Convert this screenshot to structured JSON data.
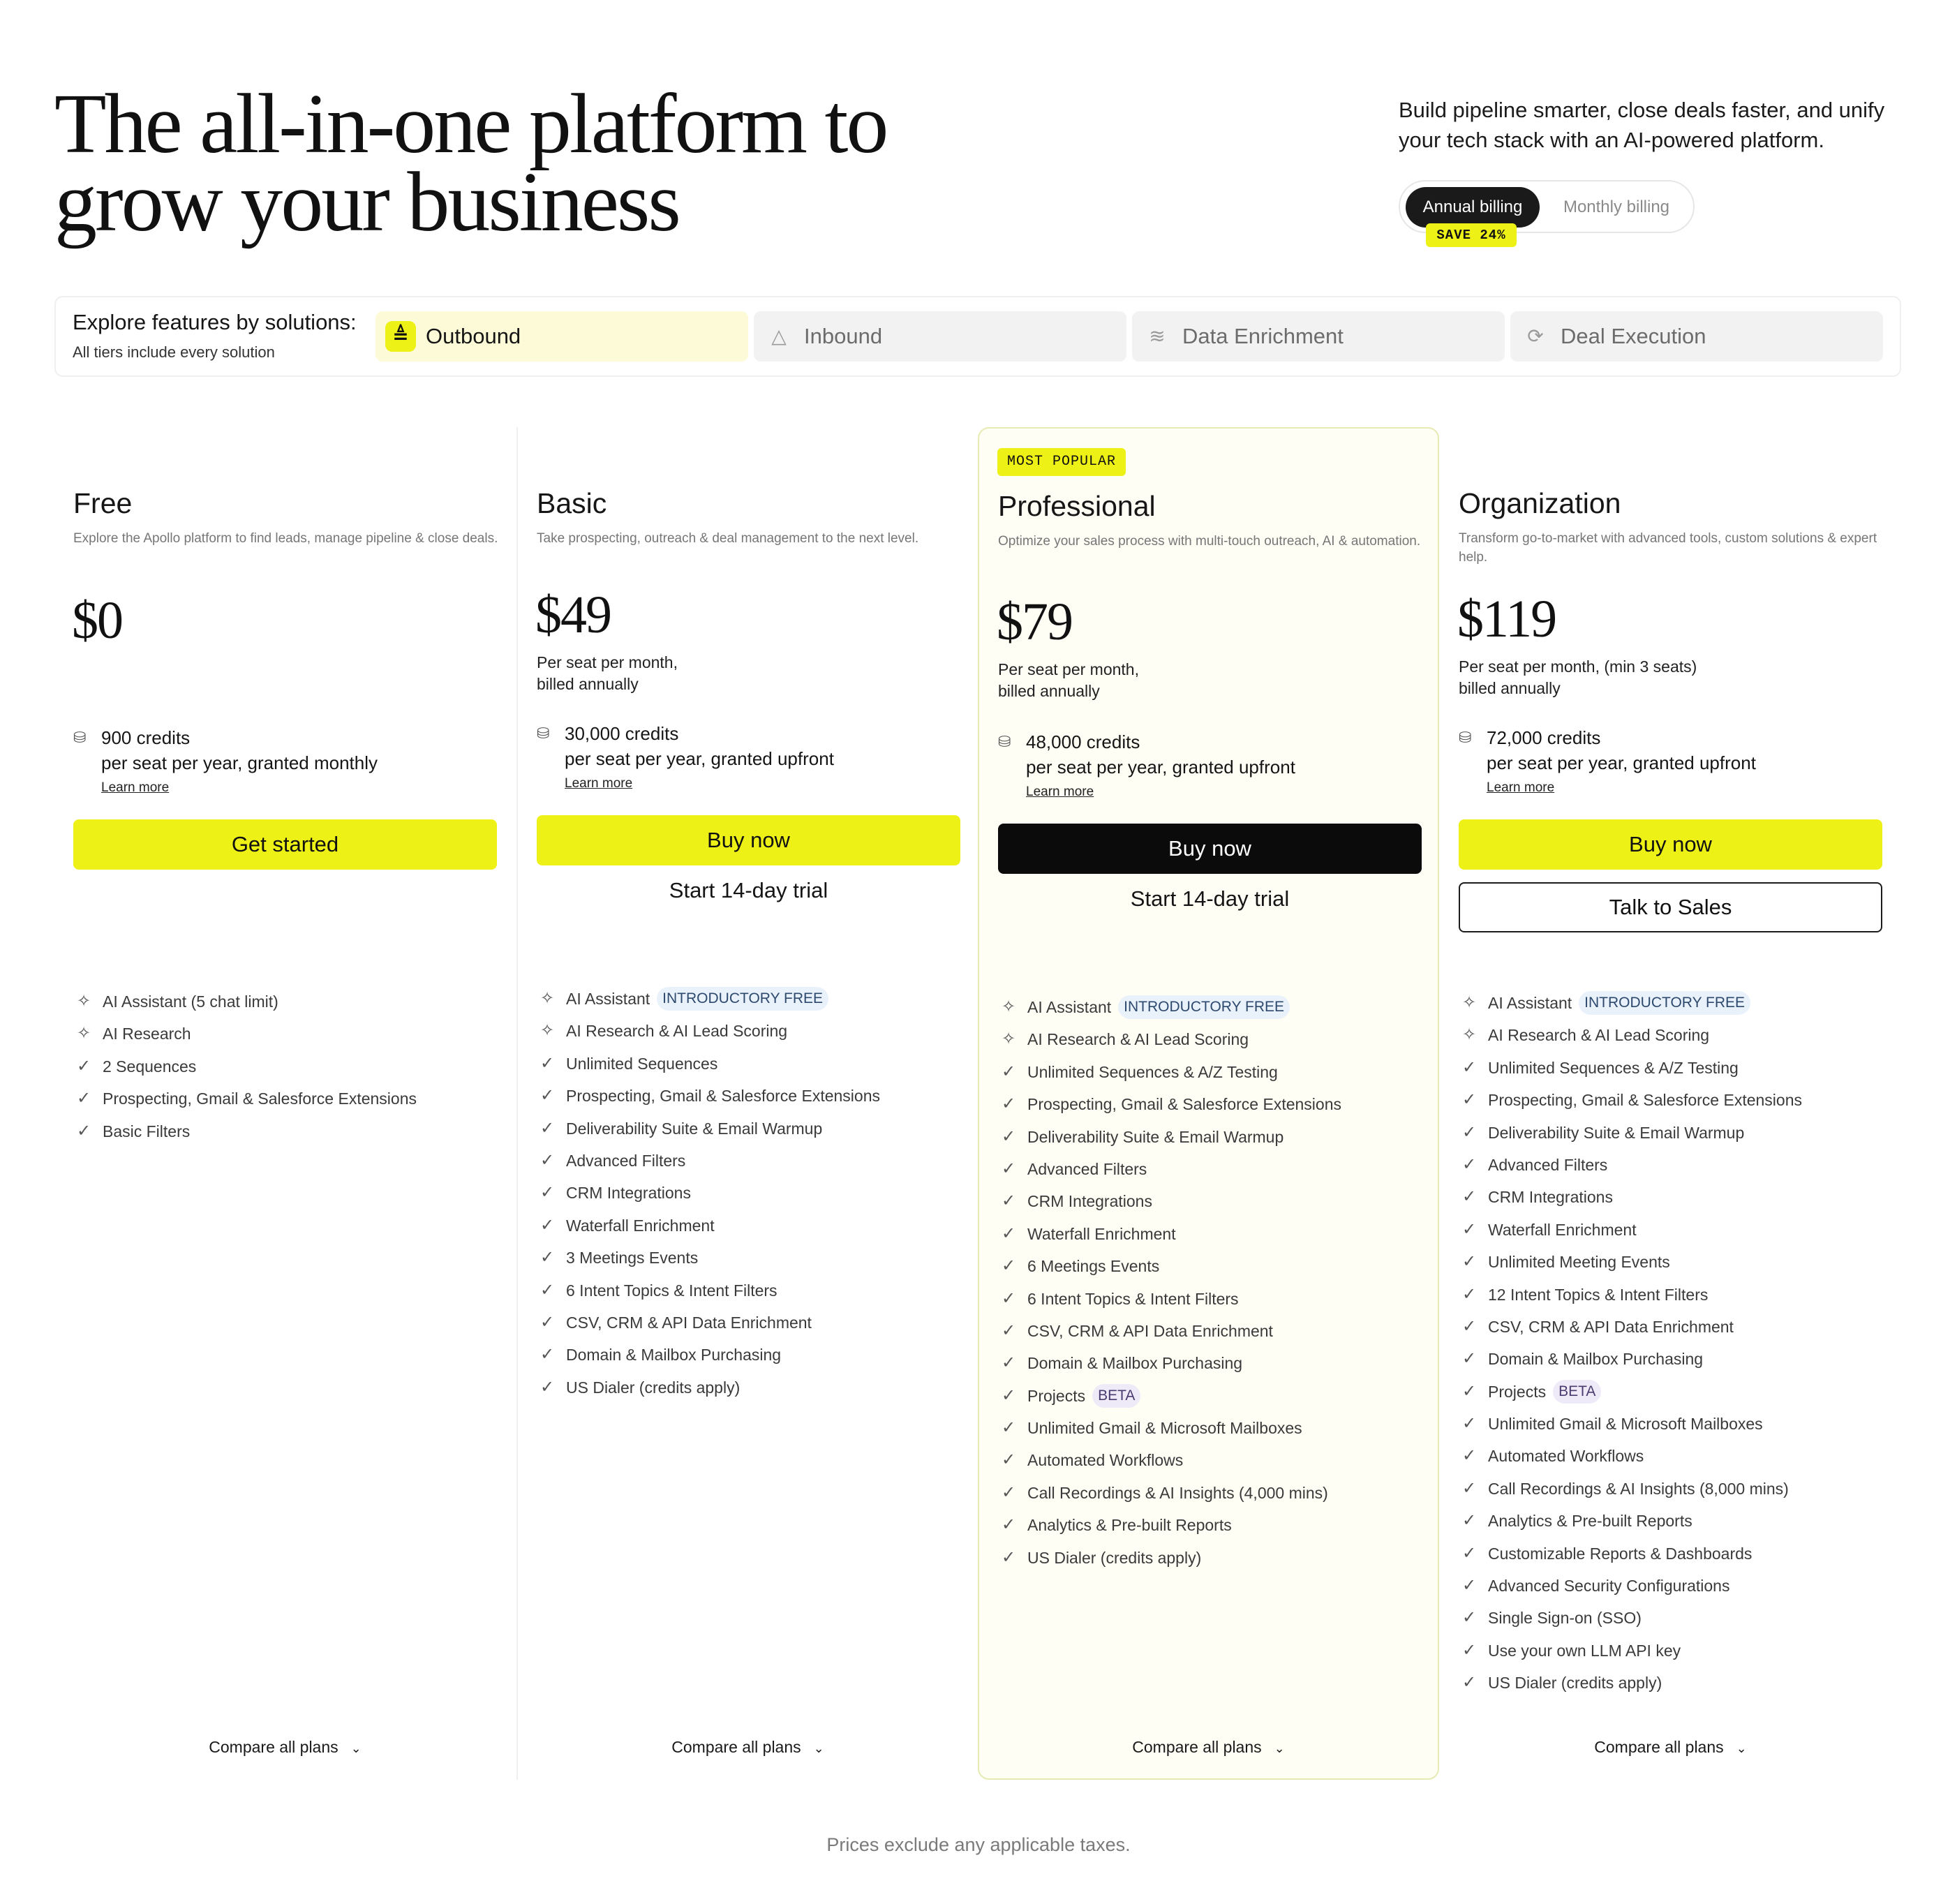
{
  "header": {
    "title_line1": "The all-in-one platform to",
    "title_line2": "grow your business",
    "subtitle": "Build pipeline smarter, close deals faster, and unify your tech stack with an AI-powered platform."
  },
  "billing": {
    "annual_label": "Annual billing",
    "monthly_label": "Monthly billing",
    "save_label": "SAVE 24%",
    "selected": "Annual billing"
  },
  "solutions": {
    "title": "Explore features by solutions:",
    "note": "All tiers include every solution",
    "tabs": [
      {
        "label": "Outbound",
        "icon": "outbound-icon",
        "active": true
      },
      {
        "label": "Inbound",
        "icon": "inbound-icon",
        "active": false
      },
      {
        "label": "Data Enrichment",
        "icon": "data-enrichment-icon",
        "active": false
      },
      {
        "label": "Deal Execution",
        "icon": "deal-execution-icon",
        "active": false
      }
    ]
  },
  "plans": [
    {
      "name": "Free",
      "description": "Explore the Apollo platform to find leads, manage pipeline & close deals.",
      "price": "$0",
      "billing": [
        "",
        ""
      ],
      "credits_amount": "900 credits",
      "credits_detail": "per seat per year, granted monthly",
      "learn_more": "Learn more",
      "primary_cta": "Get started",
      "secondary_cta": "",
      "features": [
        {
          "text": "AI Assistant (5 chat limit)",
          "icon": "sparkle-icon",
          "badge": ""
        },
        {
          "text": "AI Research",
          "icon": "sparkle-icon",
          "badge": ""
        },
        {
          "text": "2 Sequences",
          "icon": "check-icon",
          "badge": ""
        },
        {
          "text": "Prospecting, Gmail & Salesforce Extensions",
          "icon": "check-icon",
          "badge": ""
        },
        {
          "text": "Basic Filters",
          "icon": "check-icon",
          "badge": ""
        }
      ],
      "compare": "Compare all plans"
    },
    {
      "name": "Basic",
      "description": "Take prospecting, outreach & deal management to the next level.",
      "price": "$49",
      "billing": [
        "Per seat per month,",
        "billed annually"
      ],
      "credits_amount": "30,000 credits",
      "credits_detail": "per seat per year, granted upfront",
      "learn_more": "Learn more",
      "primary_cta": "Buy now",
      "secondary_cta": "Start 14-day trial",
      "features": [
        {
          "text": "AI Assistant",
          "icon": "sparkle-icon",
          "badge": "INTRODUCTORY FREE"
        },
        {
          "text": "AI Research & AI Lead Scoring",
          "icon": "sparkle-icon",
          "badge": ""
        },
        {
          "text": "Unlimited Sequences",
          "icon": "check-icon",
          "badge": ""
        },
        {
          "text": "Prospecting, Gmail & Salesforce Extensions",
          "icon": "check-icon",
          "badge": ""
        },
        {
          "text": "Deliverability Suite & Email Warmup",
          "icon": "check-icon",
          "badge": ""
        },
        {
          "text": "Advanced Filters",
          "icon": "check-icon",
          "badge": ""
        },
        {
          "text": "CRM Integrations",
          "icon": "check-icon",
          "badge": ""
        },
        {
          "text": "Waterfall Enrichment",
          "icon": "check-icon",
          "badge": ""
        },
        {
          "text": "3 Meetings Events",
          "icon": "check-icon",
          "badge": ""
        },
        {
          "text": "6 Intent Topics & Intent Filters",
          "icon": "check-icon",
          "badge": ""
        },
        {
          "text": "CSV, CRM & API Data Enrichment",
          "icon": "check-icon",
          "badge": ""
        },
        {
          "text": "Domain & Mailbox Purchasing",
          "icon": "check-icon",
          "badge": ""
        },
        {
          "text": "US Dialer (credits apply)",
          "icon": "check-icon",
          "badge": ""
        }
      ],
      "compare": "Compare all plans"
    },
    {
      "name": "Professional",
      "badge": "MOST POPULAR",
      "description": "Optimize your sales process with multi-touch outreach, AI & automation.",
      "price": "$79",
      "billing": [
        "Per seat per month,",
        "billed annually"
      ],
      "credits_amount": "48,000 credits",
      "credits_detail": "per seat per year, granted upfront",
      "learn_more": "Learn more",
      "primary_cta": "Buy now",
      "secondary_cta": "Start 14-day trial",
      "features": [
        {
          "text": "AI Assistant",
          "icon": "sparkle-icon",
          "badge": "INTRODUCTORY FREE"
        },
        {
          "text": "AI Research & AI Lead Scoring",
          "icon": "sparkle-icon",
          "badge": ""
        },
        {
          "text": "Unlimited Sequences & A/Z Testing",
          "icon": "check-icon",
          "badge": ""
        },
        {
          "text": "Prospecting, Gmail & Salesforce Extensions",
          "icon": "check-icon",
          "badge": ""
        },
        {
          "text": "Deliverability Suite & Email Warmup",
          "icon": "check-icon",
          "badge": ""
        },
        {
          "text": "Advanced Filters",
          "icon": "check-icon",
          "badge": ""
        },
        {
          "text": "CRM Integrations",
          "icon": "check-icon",
          "badge": ""
        },
        {
          "text": "Waterfall Enrichment",
          "icon": "check-icon",
          "badge": ""
        },
        {
          "text": "6 Meetings Events",
          "icon": "check-icon",
          "badge": ""
        },
        {
          "text": "6 Intent Topics & Intent Filters",
          "icon": "check-icon",
          "badge": ""
        },
        {
          "text": "CSV, CRM & API Data Enrichment",
          "icon": "check-icon",
          "badge": ""
        },
        {
          "text": "Domain & Mailbox Purchasing",
          "icon": "check-icon",
          "badge": ""
        },
        {
          "text": "Projects",
          "icon": "check-icon",
          "badge": "BETA"
        },
        {
          "text": "Unlimited Gmail & Microsoft Mailboxes",
          "icon": "check-icon",
          "badge": ""
        },
        {
          "text": "Automated Workflows",
          "icon": "check-icon",
          "badge": ""
        },
        {
          "text": "Call Recordings & AI Insights (4,000 mins)",
          "icon": "check-icon",
          "badge": ""
        },
        {
          "text": "Analytics & Pre-built Reports",
          "icon": "check-icon",
          "badge": ""
        },
        {
          "text": "US Dialer (credits apply)",
          "icon": "check-icon",
          "badge": ""
        }
      ],
      "compare": "Compare all plans"
    },
    {
      "name": "Organization",
      "description": "Transform go-to-market with advanced tools, custom solutions & expert help.",
      "price": "$119",
      "billing": [
        "Per seat per month, (min 3 seats)",
        "billed annually"
      ],
      "credits_amount": "72,000 credits",
      "credits_detail": "per seat per year, granted upfront",
      "learn_more": "Learn more",
      "primary_cta": "Buy now",
      "secondary_cta": "Talk to Sales",
      "features": [
        {
          "text": "AI Assistant",
          "icon": "sparkle-icon",
          "badge": "INTRODUCTORY FREE"
        },
        {
          "text": "AI Research & AI Lead Scoring",
          "icon": "sparkle-icon",
          "badge": ""
        },
        {
          "text": "Unlimited Sequences & A/Z Testing",
          "icon": "check-icon",
          "badge": ""
        },
        {
          "text": "Prospecting, Gmail & Salesforce Extensions",
          "icon": "check-icon",
          "badge": ""
        },
        {
          "text": "Deliverability Suite & Email Warmup",
          "icon": "check-icon",
          "badge": ""
        },
        {
          "text": "Advanced Filters",
          "icon": "check-icon",
          "badge": ""
        },
        {
          "text": "CRM Integrations",
          "icon": "check-icon",
          "badge": ""
        },
        {
          "text": "Waterfall Enrichment",
          "icon": "check-icon",
          "badge": ""
        },
        {
          "text": "Unlimited Meeting Events",
          "icon": "check-icon",
          "badge": ""
        },
        {
          "text": "12 Intent Topics & Intent Filters",
          "icon": "check-icon",
          "badge": ""
        },
        {
          "text": "CSV, CRM & API Data Enrichment",
          "icon": "check-icon",
          "badge": ""
        },
        {
          "text": "Domain & Mailbox Purchasing",
          "icon": "check-icon",
          "badge": ""
        },
        {
          "text": "Projects",
          "icon": "check-icon",
          "badge": "BETA"
        },
        {
          "text": "Unlimited Gmail & Microsoft Mailboxes",
          "icon": "check-icon",
          "badge": ""
        },
        {
          "text": "Automated Workflows",
          "icon": "check-icon",
          "badge": ""
        },
        {
          "text": "Call Recordings & AI Insights (8,000 mins)",
          "icon": "check-icon",
          "badge": ""
        },
        {
          "text": "Analytics & Pre-built Reports",
          "icon": "check-icon",
          "badge": ""
        },
        {
          "text": "Customizable Reports & Dashboards",
          "icon": "check-icon",
          "badge": ""
        },
        {
          "text": "Advanced Security Configurations",
          "icon": "check-icon",
          "badge": ""
        },
        {
          "text": "Single Sign-on (SSO)",
          "icon": "check-icon",
          "badge": ""
        },
        {
          "text": "Use your own LLM API key",
          "icon": "check-icon",
          "badge": ""
        },
        {
          "text": "US Dialer (credits apply)",
          "icon": "check-icon",
          "badge": ""
        }
      ],
      "compare": "Compare all plans"
    }
  ],
  "footer": {
    "note": "Prices exclude any applicable taxes."
  },
  "colors": {
    "accent_yellow": "#edf116",
    "highlight_background": "#fffef5",
    "text_primary": "#121212",
    "text_muted": "#767676"
  }
}
